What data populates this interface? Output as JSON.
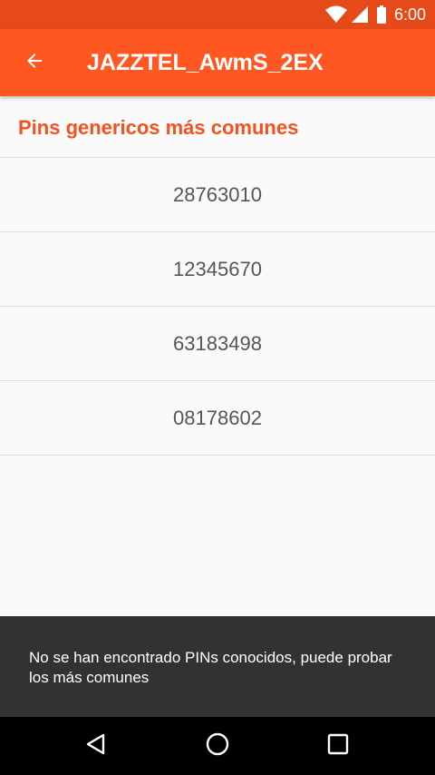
{
  "status_bar": {
    "time": "6:00",
    "icons": [
      "wifi-icon",
      "signal-icon",
      "battery-icon"
    ]
  },
  "app_bar": {
    "back_icon": "arrow-back-icon",
    "title": "JAZZTEL_AwmS_2EX"
  },
  "section": {
    "title": "Pins genericos más comunes"
  },
  "pins": [
    "28763010",
    "12345670",
    "63183498",
    "08178602"
  ],
  "snackbar": {
    "message": "No se han encontrado PINs conocidos, puede probar los más comunes"
  },
  "nav_bar": {
    "buttons": [
      "back-triangle-icon",
      "home-circle-icon",
      "recents-square-icon"
    ]
  },
  "colors": {
    "status_bar": "#e64a19",
    "app_bar": "#ff5722",
    "accent_text": "#f4511e",
    "snackbar": "#323232",
    "background": "#fafafa"
  }
}
